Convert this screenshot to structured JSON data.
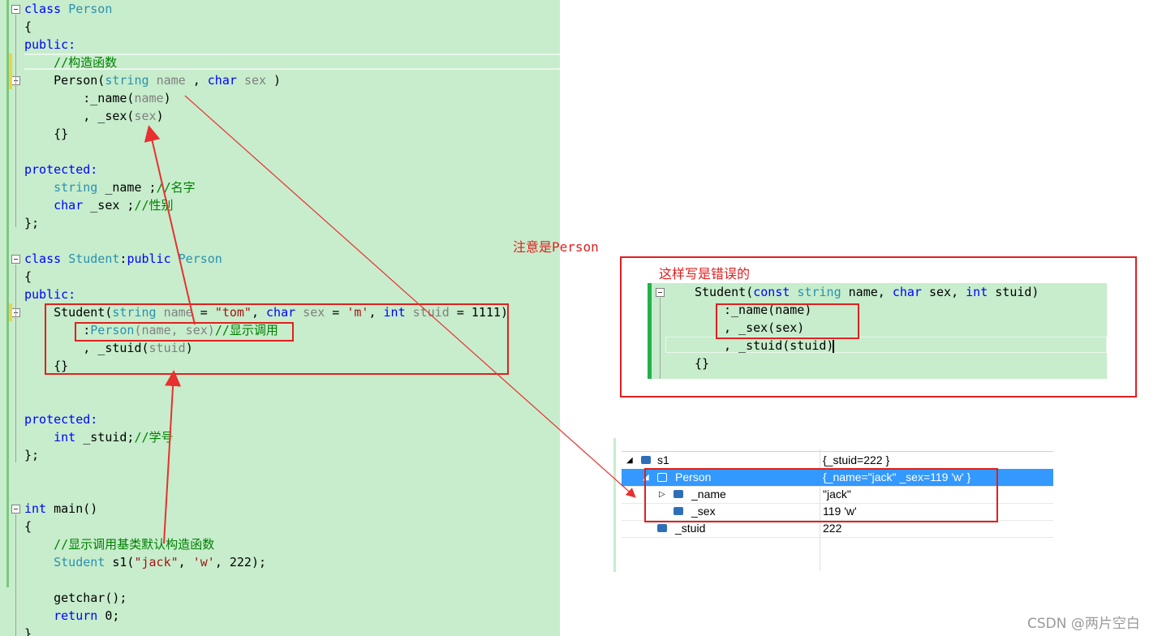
{
  "code": {
    "class_person": {
      "kw": "class",
      "name": "Person"
    },
    "brace_open": "{",
    "public": "public:",
    "comment_ctor": "//构造函数",
    "ctor": {
      "name": "Person(",
      "t1": "string",
      "p1": "name",
      "sep": " , ",
      "t2": "char",
      "p2": "sex",
      "end": " )"
    },
    "init_name": {
      "pre": ":_name(",
      "arg": "name",
      "end": ")"
    },
    "init_sex": {
      "pre": ", _sex(",
      "arg": "sex",
      "end": ")"
    },
    "empty_body": "{}",
    "protected": "protected:",
    "member_name": {
      "type": "string",
      "rest": " _name ;",
      "comment": "//名字"
    },
    "member_sex": {
      "type": "char",
      "rest": " _sex ;",
      "comment": "//性别"
    },
    "brace_close": "};",
    "class_student": {
      "kw": "class",
      "name": "Student",
      "colon": ":",
      "access": "public",
      "base": "Person"
    },
    "student_ctor": {
      "name": "Student(",
      "t1": "string",
      "p1": "name",
      "eq1": " = ",
      "d1": "\"tom\"",
      "c1": ", ",
      "t2": "char",
      "p2": "sex",
      "eq2": " = ",
      "d2": "'m'",
      "c2": ", ",
      "t3": "int",
      "p3": "stuid",
      "eq3": " = 1111)"
    },
    "init_person": {
      "pre": ":",
      "base": "Person",
      "args": "(name, sex)",
      "comment": "//显示调用"
    },
    "init_stuid": {
      "pre": ", _stuid(",
      "arg": "stuid",
      "end": ")"
    },
    "member_stuid": {
      "type": "int",
      "rest": " _stuid;",
      "comment": "//学号"
    },
    "main": {
      "type": "int",
      "rest": " main()"
    },
    "comment_main": "//显示调用基类默认构造函数",
    "student_s1": {
      "type": "Student",
      "rest": " s1(",
      "a1": "\"jack\"",
      "c1": ", ",
      "a2": "'w'",
      "end": ", 222);"
    },
    "getchar": "getchar();",
    "return": {
      "kw": "return",
      "rest": " 0;"
    },
    "last_brace": "}"
  },
  "notes": {
    "note_person": "注意是Person",
    "wrong_title": "这样写是错误的"
  },
  "snippet": {
    "ctor": {
      "name": "Student(",
      "k1": "const",
      "t1": "string",
      "r1": " name, ",
      "t2": "char",
      "r2": " sex, ",
      "t3": "int",
      "r3": " stuid)"
    },
    "l2": ":_name(name)",
    "l3": ", _sex(sex)",
    "l4": ", _stuid(stuid)",
    "l5": "{}"
  },
  "watch": {
    "rows": [
      {
        "name": "s1",
        "value": "{_stuid=222 }"
      },
      {
        "name": "Person",
        "value": "{_name=\"jack\" _sex=119 'w' }"
      },
      {
        "name": "_name",
        "value": "\"jack\""
      },
      {
        "name": "_sex",
        "value": "119 'w'"
      },
      {
        "name": "_stuid",
        "value": "222"
      }
    ]
  },
  "watermark": "CSDN @两片空白",
  "colors": {
    "editor_bg": "#c7edcc",
    "annotation_red": "#e02020",
    "selection_blue": "#3399ff"
  }
}
